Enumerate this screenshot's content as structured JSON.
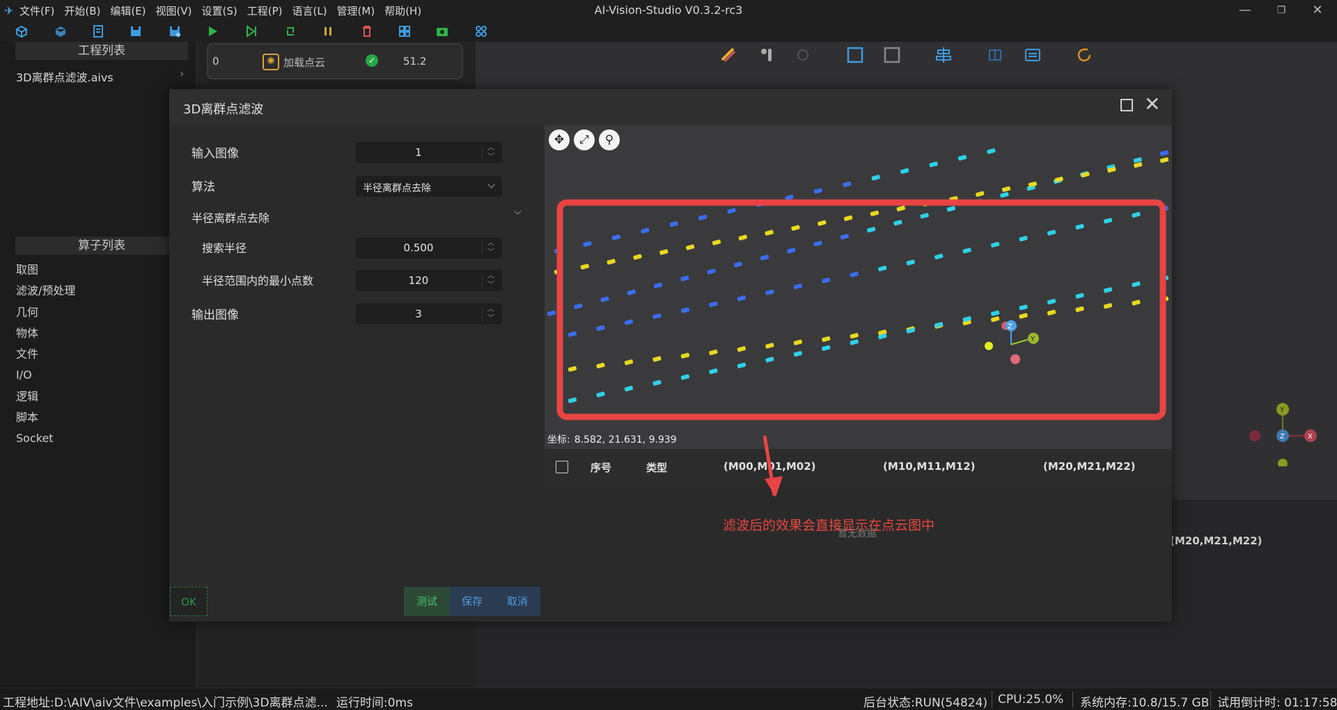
{
  "app": {
    "title": "AI-Vision-Studio V0.3.2-rc3",
    "menu": [
      "文件(F)",
      "开始(B)",
      "编辑(E)",
      "视图(V)",
      "设置(S)",
      "工程(P)",
      "语言(L)",
      "管理(M)",
      "帮助(H)"
    ]
  },
  "left": {
    "project_header": "工程列表",
    "project_file": "3D离群点滤波.aivs",
    "operator_header": "算子列表",
    "operators": [
      "取图",
      "滤波/预处理",
      "几何",
      "物体",
      "文件",
      "I/O",
      "逻辑",
      "脚本",
      "Socket"
    ]
  },
  "flow": {
    "index": "0",
    "node_name": "加载点云",
    "time": "51.2"
  },
  "modal": {
    "title": "3D离群点滤波",
    "params": {
      "input_label": "输入图像",
      "input_value": "1",
      "algo_label": "算法",
      "algo_value": "半径离群点去除",
      "section_label": "半径离群点去除",
      "radius_label": "搜索半径",
      "radius_value": "0.500",
      "minpts_label": "半径范围内的最小点数",
      "minpts_value": "120",
      "output_label": "输出图像",
      "output_value": "3"
    },
    "buttons": {
      "ok": "OK",
      "test": "测试",
      "save": "保存",
      "cancel": "取消"
    },
    "viewer": {
      "coord_label": "坐标:",
      "coord_value": "8.582, 21.631, 9.939",
      "axis_z": "Z",
      "axis_y": "Y"
    },
    "table": {
      "headers": [
        "序号",
        "类型",
        "(M00,M01,M02)",
        "(M10,M11,M12)",
        "(M20,M21,M22)"
      ],
      "empty": "暂无数据"
    },
    "annotation": "滤波后的效果会直接显示在点云图中"
  },
  "background": {
    "table_header": "(M20,M21,M22)",
    "gizmo_z": "Z",
    "gizmo_y": "Y",
    "gizmo_x": "X"
  },
  "status": {
    "project_path": "工程地址:D:\\AIV\\aiv文件\\examples\\入门示例\\3D离群点滤...",
    "runtime": "运行时间:0ms",
    "backend": "后台状态:RUN(54824)",
    "cpu": "CPU:25.0%",
    "memory": "系统内存:10.8/15.7 GB",
    "trial": "试用倒计时: 01:17:58"
  },
  "colors": {
    "accent_blue": "#4aa3e8",
    "annotation_red": "#e8473f",
    "success_green": "#27a745",
    "point_yellow": "#e8d820",
    "point_cyan": "#2fd0e8",
    "point_blue": "#3a6ef0"
  }
}
